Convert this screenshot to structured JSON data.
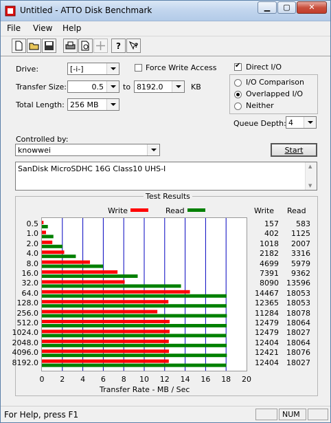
{
  "window": {
    "title": "Untitled - ATTO Disk Benchmark"
  },
  "titlebar_buttons": {
    "minimize": "▁",
    "maximize": "▢",
    "close": "✕"
  },
  "menu": [
    "File",
    "View",
    "Help"
  ],
  "toolbar": {
    "icons": [
      "new-icon",
      "open-icon",
      "save-icon",
      "print-icon",
      "print-preview-icon",
      "move-icon",
      "help-icon",
      "context-help-icon"
    ]
  },
  "form": {
    "drive_label": "Drive:",
    "drive_value": "[-i-]",
    "force_write_label": "Force Write Access",
    "force_write_checked": false,
    "direct_io_label": "Direct I/O",
    "direct_io_checked": true,
    "transfer_size_label": "Transfer Size:",
    "transfer_from": "0.5",
    "transfer_to_label": "to",
    "transfer_to": "8192.0",
    "transfer_unit": "KB",
    "total_length_label": "Total Length:",
    "total_length": "256 MB",
    "io_options": [
      "I/O Comparison",
      "Overlapped I/O",
      "Neither"
    ],
    "io_selected": 1,
    "queue_depth_label": "Queue Depth:",
    "queue_depth": "4",
    "controlled_by_label": "Controlled by:",
    "controlled_by": "knowwei",
    "start_label": "Start",
    "description": "SanDisk MicroSDHC 16G Class10 UHS-I"
  },
  "results": {
    "title": "Test Results",
    "write_legend": "Write",
    "read_legend": "Read",
    "write_header": "Write",
    "read_header": "Read"
  },
  "chart_data": {
    "type": "bar",
    "orientation": "horizontal",
    "categories": [
      "0.5",
      "1.0",
      "2.0",
      "4.0",
      "8.0",
      "16.0",
      "32.0",
      "64.0",
      "128.0",
      "256.0",
      "512.0",
      "1024.0",
      "2048.0",
      "4096.0",
      "8192.0"
    ],
    "series": [
      {
        "name": "Write",
        "color": "#ff0000",
        "values": [
          157,
          402,
          1018,
          2182,
          4699,
          7391,
          8090,
          14467,
          12365,
          11284,
          12479,
          12479,
          12404,
          12421,
          12404
        ]
      },
      {
        "name": "Read",
        "color": "#008000",
        "values": [
          583,
          1125,
          2007,
          3316,
          5979,
          9362,
          13596,
          18053,
          18053,
          18078,
          18064,
          18027,
          18064,
          18076,
          18027
        ]
      }
    ],
    "xlabel": "Transfer Rate - MB / Sec",
    "xlim": [
      0,
      20
    ],
    "xticks": [
      "0",
      "2",
      "4",
      "6",
      "8",
      "10",
      "12",
      "14",
      "16",
      "18",
      "20"
    ],
    "grid": true
  },
  "status": {
    "text": "For Help, press F1",
    "num": "NUM"
  }
}
